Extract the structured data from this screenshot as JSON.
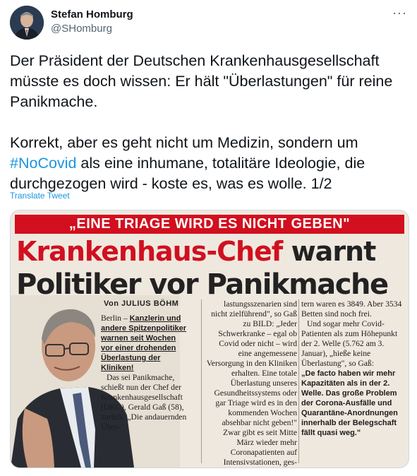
{
  "author": {
    "name": "Stefan Homburg",
    "handle": "@SHomburg"
  },
  "menu_label": "···",
  "tweet": {
    "para1": "Der Präsident der Deutschen Krankenhausgesellschaft müsste es doch wissen: Er hält \"Überlastungen\" für reine Panikmache.",
    "para2_before": "Korrekt, aber es geht nicht um Medizin, sondern um ",
    "hashtag": "#NoCovid",
    "para2_after": " als eine inhumane, totalitäre Ideologie, die durchgezogen wird - koste es, was es wolle. 1/2",
    "translate": "Translate Tweet"
  },
  "clipping": {
    "banner": "„EINE TRIAGE WIRD ES NICHT GEBEN\"",
    "headline_red": "Krankenhaus-Chef",
    "headline_dark": " warnt",
    "headline_line2": "Politiker vor Panikmache",
    "byline": "Von JULIUS BÖHM",
    "col1_lead": "Berlin – ",
    "col1_bold": "Kanzlerin und andere Spitzenpolitiker warnen seit Wochen vor einer drohenden Überlastung der Kliniken!",
    "col1_p2": "Das sei Panikmache, schießt nun der Chef der Krankenhausgesellschaft (DKG), Gerald Gaß (58), zurück. „Die andauernden Über-",
    "col2_p1": "lastungsszenarien sind nicht zielführend\", so Gaß zu BILD: „Jeder Schwerkranke – egal ob Covid oder nicht – wird eine angemessene Versorgung in den Kliniken erhalten. Eine totale Überlastung unseres Gesundheitssystems oder gar Triage wird es in den kommenden Wochen absehbar nicht geben!\"",
    "col2_p2": "Zwar gibt es seit Mitte März wieder mehr Coronapatienten auf Intensivstationen, ges-",
    "col3_p1": "tern waren es 3849. Aber 3534 Betten sind noch frei.",
    "col3_p2": "Und sogar mehr Covid-Patienten als zum Höhepunkt der 2. Welle (5.762 am 3. Januar), „hieße keine Überlastung\", so Gaß:",
    "col3_bold": "„De facto haben wir mehr Kapazitäten als in der 2. Welle. Das große Problem der Corona-Ausfälle und Quarantäne-Anordnungen innerhalb der Belegschaft fällt quasi weg.\""
  },
  "colors": {
    "hashtag": "#1b95e0",
    "banner": "#d20f1e",
    "headline_red": "#d01020"
  },
  "icons": [
    "avatar",
    "more-options-icon"
  ]
}
